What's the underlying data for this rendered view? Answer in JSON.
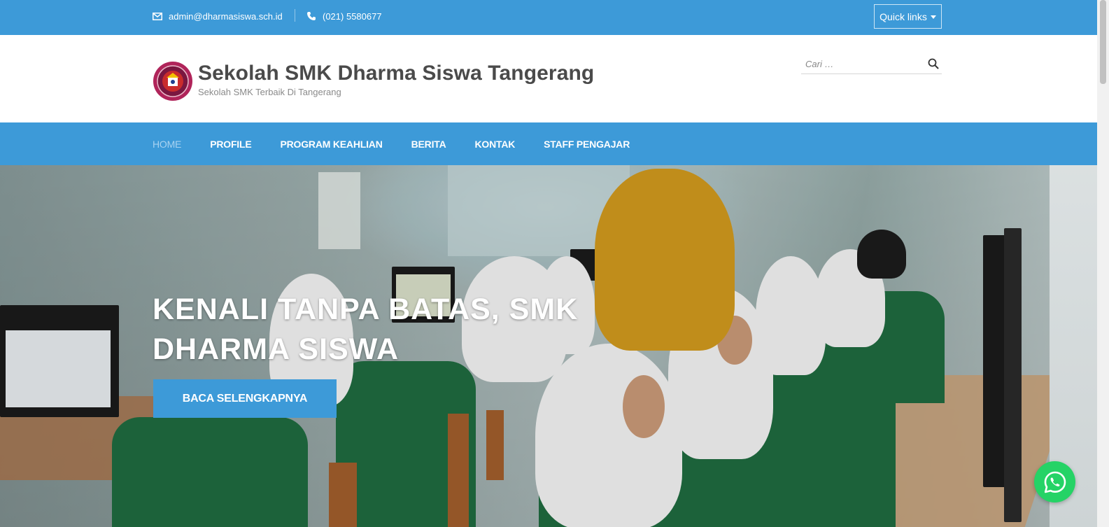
{
  "topbar": {
    "email": "admin@dharmasiswa.sch.id",
    "phone": "(021) 5580677",
    "quick_links_label": "Quick links"
  },
  "header": {
    "site_title": "Sekolah SMK Dharma Siswa Tangerang",
    "tagline": "Sekolah SMK Terbaik Di Tangerang",
    "search_placeholder": "Cari …"
  },
  "nav": {
    "items": [
      {
        "label": "HOME",
        "active": true
      },
      {
        "label": "PROFILE"
      },
      {
        "label": "PROGRAM KEAHLIAN"
      },
      {
        "label": "BERITA"
      },
      {
        "label": "KONTAK"
      },
      {
        "label": "STAFF PENGAJAR"
      }
    ]
  },
  "hero": {
    "title": "KENALI TANPA BATAS, SMK DHARMA SISWA",
    "button_label": "BACA SELENGKAPNYA"
  },
  "icons": {
    "email": "envelope-icon",
    "phone": "phone-icon",
    "search": "search-icon",
    "whatsapp": "whatsapp-icon",
    "logo": "school-logo"
  },
  "colors": {
    "primary": "#3d9ad8",
    "nav_active": "#a9d3f1",
    "title_text": "#4a4a4a",
    "whatsapp": "#25d366"
  }
}
